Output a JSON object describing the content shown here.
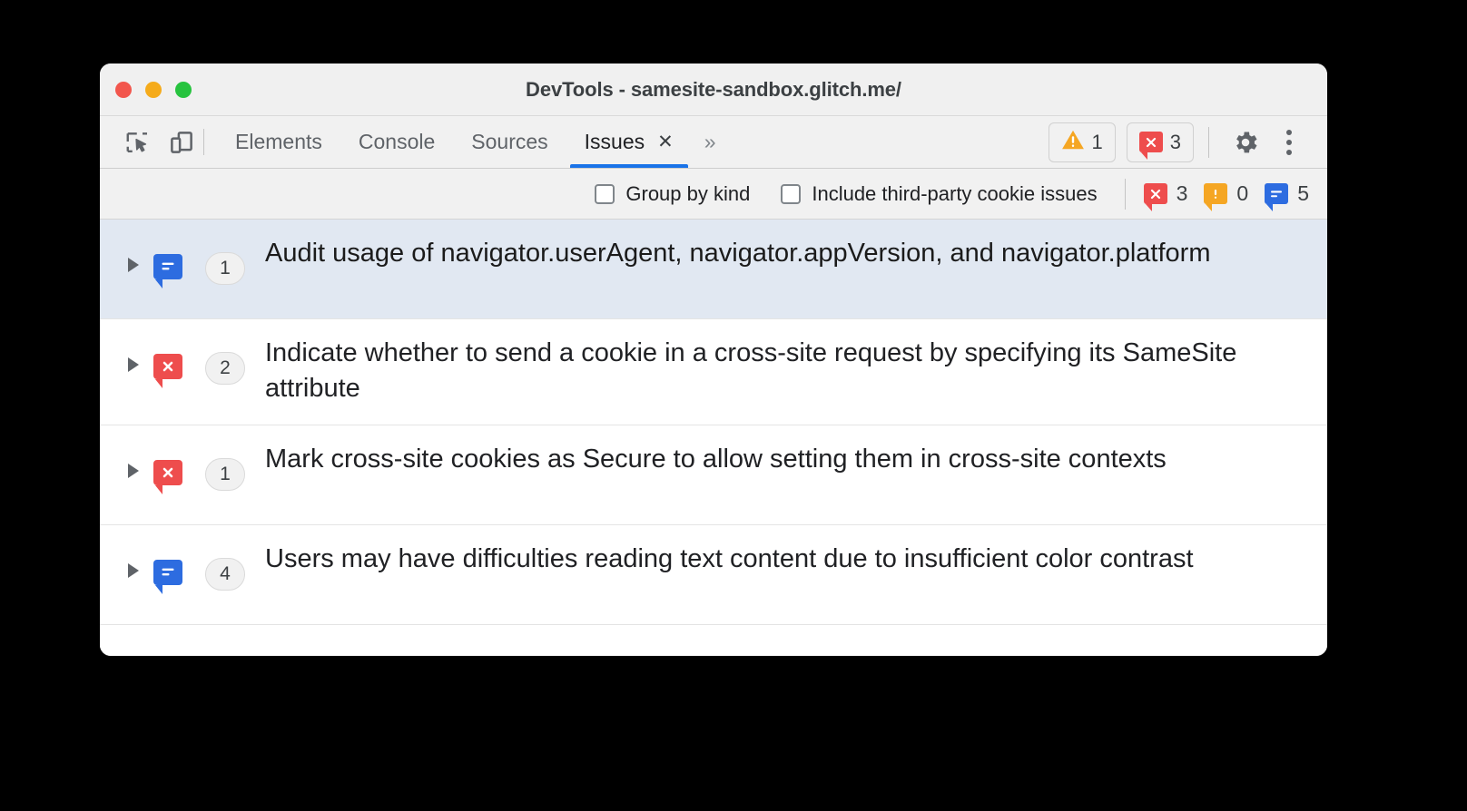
{
  "window": {
    "title": "DevTools - samesite-sandbox.glitch.me/",
    "traffic_lights": [
      "close-red",
      "minimize-yellow",
      "maximize-green"
    ]
  },
  "toolbar": {
    "inspect_icon": "inspect-element-icon",
    "device_icon": "device-toolbar-icon",
    "tabs": [
      {
        "label": "Elements",
        "active": false
      },
      {
        "label": "Console",
        "active": false
      },
      {
        "label": "Sources",
        "active": false
      },
      {
        "label": "Issues",
        "active": true,
        "closeable": true
      }
    ],
    "tab_close_glyph": "✕",
    "more_tabs_glyph": "»",
    "warning_chip": {
      "icon": "warning-triangle-icon",
      "count": "1"
    },
    "error_chip": {
      "icon": "error-bubble-icon",
      "count": "3"
    },
    "settings_icon": "gear-icon",
    "menu_icon": "kebab-menu-icon"
  },
  "filters": {
    "group_by_kind": {
      "label": "Group by kind",
      "checked": false
    },
    "third_party": {
      "label": "Include third-party cookie issues",
      "checked": false
    },
    "counts": {
      "errors": "3",
      "warnings": "0",
      "info": "5"
    }
  },
  "issues": [
    {
      "kind": "info",
      "count": "1",
      "title": "Audit usage of navigator.userAgent, navigator.appVersion, and navigator.platform",
      "selected": true
    },
    {
      "kind": "error",
      "count": "2",
      "title": "Indicate whether to send a cookie in a cross-site request by specifying its SameSite attribute",
      "selected": false
    },
    {
      "kind": "error",
      "count": "1",
      "title": "Mark cross-site cookies as Secure to allow setting them in cross-site contexts",
      "selected": false
    },
    {
      "kind": "info",
      "count": "4",
      "title": "Users may have difficulties reading text content due to insufficient color contrast",
      "selected": false
    }
  ],
  "colors": {
    "accent": "#1a73e8",
    "error": "#ee4d4d",
    "warning": "#f5a623",
    "info": "#2d6ce0",
    "selected_row": "#e1e8f2",
    "chrome": "#f1f1f1"
  }
}
